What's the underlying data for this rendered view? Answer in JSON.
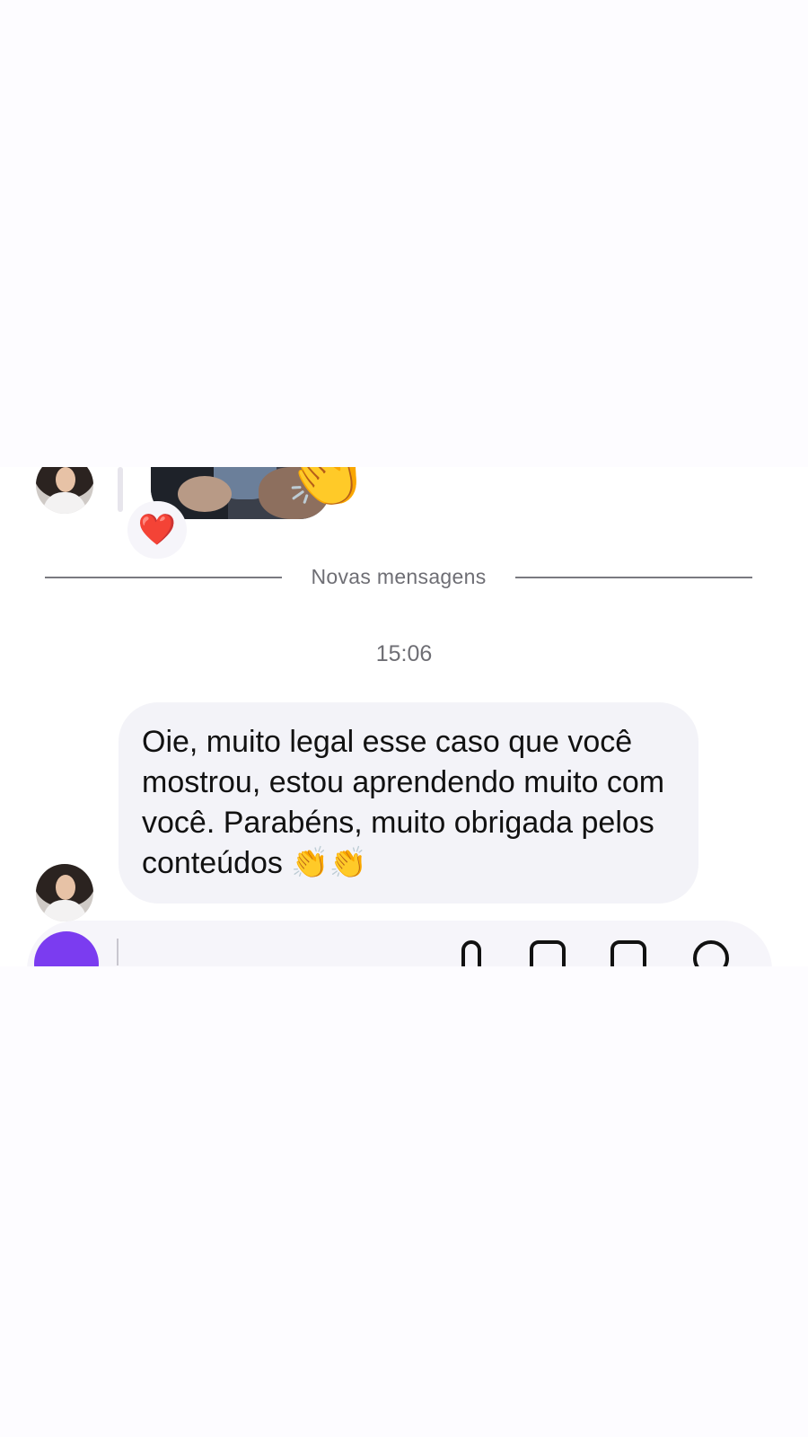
{
  "conversation": {
    "previous_reaction": {
      "emoji": "❤️",
      "icon": "heart-icon"
    },
    "previous_media_emoji": "👏",
    "divider_label": "Novas mensagens",
    "timestamp": "15:06",
    "message": {
      "text": "Oie, muito legal esse caso que você mostrou, estou aprendendo muito com você. Parabéns, muito obrigada pelos conteúdos",
      "emoji": "👏👏"
    }
  },
  "composer": {
    "camera_icon": "camera-icon",
    "mic_icon": "microphone-icon",
    "gallery_icon": "gallery-icon",
    "sticker_icon": "sticker-icon",
    "plus_icon": "plus-circle-icon",
    "accent": "#7b3cf0"
  },
  "colors": {
    "background": "#ffffff",
    "bubble": "#f3f3f8",
    "text": "#111111",
    "meta_text": "#6e6e74",
    "heart": "#e8202b"
  }
}
